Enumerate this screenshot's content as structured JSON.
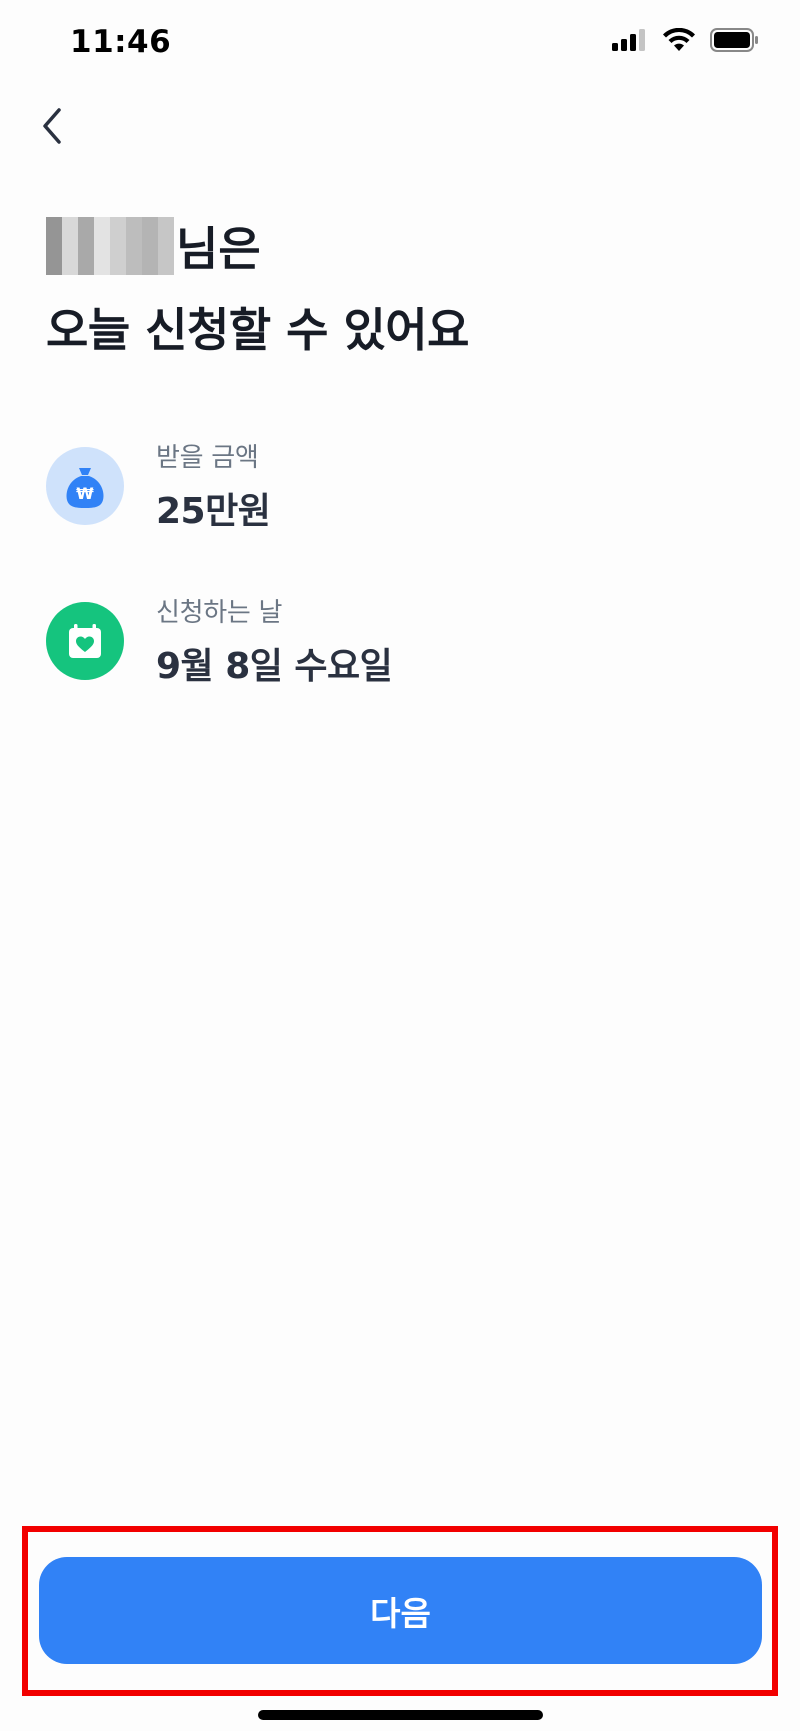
{
  "status_bar": {
    "time": "11:46",
    "icons": [
      "cellular-signal-icon",
      "wifi-icon",
      "battery-icon"
    ]
  },
  "nav": {
    "back_icon": "chevron-left-icon"
  },
  "heading": {
    "name_suffix": "님은",
    "line2": "오늘 신청할 수 있어요"
  },
  "info": {
    "amount": {
      "icon": "money-bag-won-icon",
      "label": "받을 금액",
      "value": "25만원",
      "icon_bg": "#cfe2fb",
      "icon_color": "#3182f6"
    },
    "date": {
      "icon": "calendar-heart-icon",
      "label": "신청하는 날",
      "value": "9월 8일 수요일",
      "icon_bg": "#15c47e",
      "icon_color": "#ffffff"
    }
  },
  "cta": {
    "next_label": "다음",
    "button_color": "#3182f6",
    "highlight_color": "#f20000"
  }
}
